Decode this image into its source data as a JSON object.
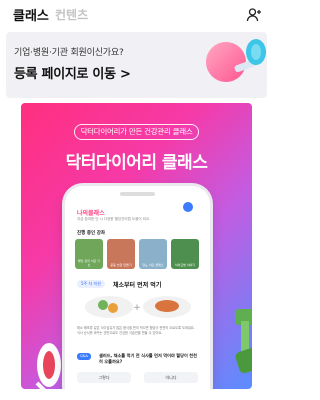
{
  "header": {
    "tab_active": "클래스",
    "tab_inactive": "컨텐츠",
    "profile_icon": "person-add-icon"
  },
  "banner": {
    "subtitle": "기업·병원·기관 회원이신가요?",
    "cta": "등록 페이지로 이동 >",
    "art_icon": "dumbbell-illustration"
  },
  "hero": {
    "pill": "닥터다이어리가 만든 건강관리 클래스",
    "title": "닥터다이어리 클래스",
    "gradient": [
      "#ff2f7e",
      "#c45be0",
      "#5a8dff"
    ]
  },
  "phone": {
    "title": "나의클래스",
    "desc": "지금 참여한 단 시 다양한 혈당관리법 도움이 되요",
    "section": "진행 중인 강좌",
    "cards": [
      {
        "label": "혈당 관리 식단 기초",
        "color": "#6fa65a"
      },
      {
        "label": "운동 습관 만들기",
        "color": "#c9775a"
      },
      {
        "label": "당뇨 식단 클래스",
        "color": "#8ab1c9"
      },
      {
        "label": "식이요법 이야기",
        "color": "#4e8e4f"
      }
    ],
    "tag": "5주 차 미션",
    "heading": "채소부터 먼저 먹기",
    "body": "채소·해조류 같은 식이섬유가 많은 음식을 먼저 먹으면 혈당이 천천히 오르도록 도와줘요. 식사 순서를 바꾸는 것만으로도 건강한 식습관을 만들 수 있어요.",
    "q_badge": "Q&A",
    "question": "샐러드, 채소를 먹기 전 식사를 먼저 먹어야 혈당이 천천히 오를까요?",
    "btn_left": "그렇다",
    "btn_right": "아니다",
    "accent": "#3b7bff"
  }
}
